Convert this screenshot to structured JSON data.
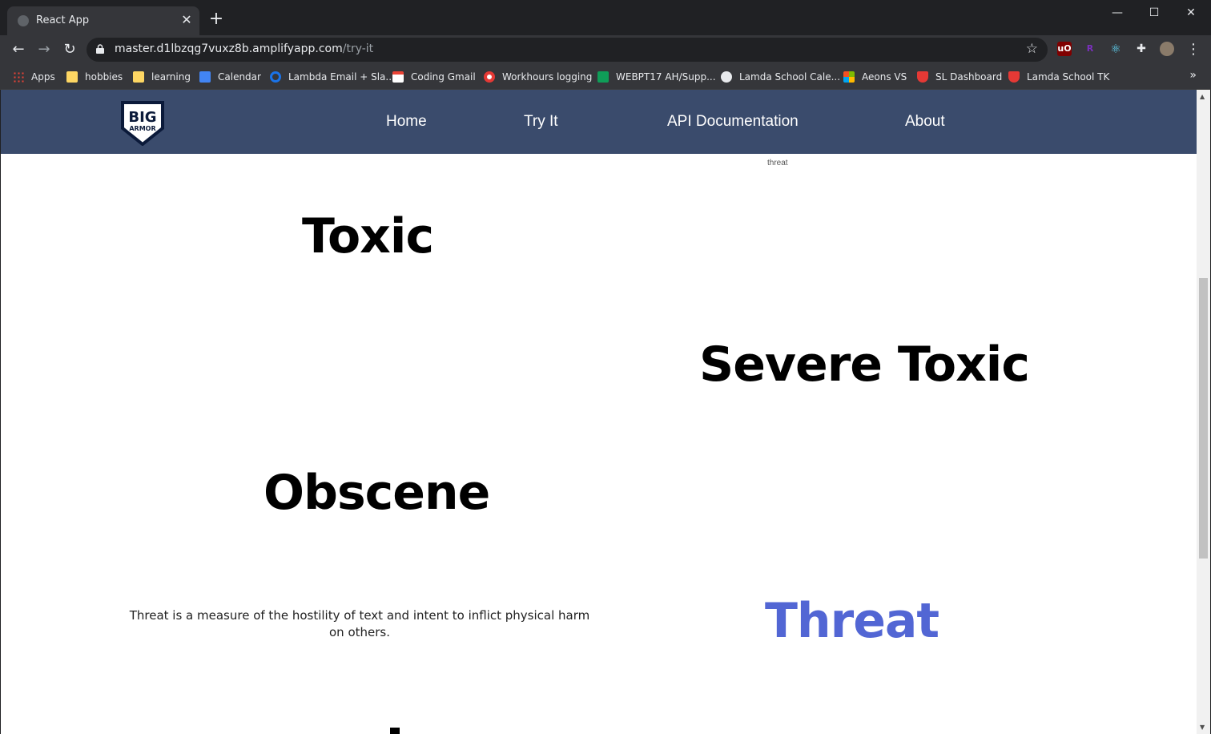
{
  "browser": {
    "tab_title": "React App",
    "tab_close": "✕",
    "new_tab": "+",
    "window_controls": {
      "minimize": "—",
      "maximize": "☐",
      "close": "✕"
    },
    "url_host": "master.d1lbzqg7vuxz8b.amplifyapp.com",
    "url_path": "/try-it",
    "bookmarks": [
      {
        "label": "Apps",
        "icon": "apps-grid-icon",
        "color": "#ea4335"
      },
      {
        "label": "hobbies",
        "icon": "folder-icon",
        "color": "#fdd663"
      },
      {
        "label": "learning",
        "icon": "folder-icon",
        "color": "#fdd663"
      },
      {
        "label": "Calendar",
        "icon": "calendar-icon",
        "color": "#4285f4"
      },
      {
        "label": "Lambda Email + Sla...",
        "icon": "circle-icon",
        "color": "#1a73e8"
      },
      {
        "label": "Coding Gmail",
        "icon": "gmail-icon",
        "color": "#ea4335"
      },
      {
        "label": "Workhours logging",
        "icon": "target-icon",
        "color": "#e53935"
      },
      {
        "label": "WEBPT17 AH/Supp...",
        "icon": "sheets-plus-icon",
        "color": "#0f9d58"
      },
      {
        "label": "Lamda School Cale...",
        "icon": "globe-icon",
        "color": "#e8eaed"
      },
      {
        "label": "Aeons VS",
        "icon": "microsoft-icon",
        "color": "#f25022"
      },
      {
        "label": "SL Dashboard",
        "icon": "lambda-shield-icon",
        "color": "#e53935"
      },
      {
        "label": "Lamda School TK",
        "icon": "lambda-shield-icon",
        "color": "#e53935"
      }
    ],
    "extensions": [
      {
        "label": "uO",
        "color": "#800000"
      },
      {
        "label": "R",
        "color": "#7b2fbe"
      },
      {
        "label": "⚛",
        "color": "#61dafb"
      },
      {
        "label": "✚",
        "color": "#e8eaed"
      }
    ]
  },
  "site": {
    "logo_text_top": "BIG",
    "logo_text_bottom": "ARMOR",
    "nav": [
      {
        "label": "Home"
      },
      {
        "label": "Try It"
      },
      {
        "label": "API Documentation"
      },
      {
        "label": "About"
      }
    ],
    "small_label": "threat",
    "categories": {
      "toxic": "Toxic",
      "severe_toxic": "Severe Toxic",
      "obscene": "Obscene",
      "threat": "Threat"
    },
    "threat_description": "Threat is a measure of the hostility of text and intent to inflict physical harm on others.",
    "active_color": "#5266d4",
    "nav_bg": "#3a4b6c"
  }
}
